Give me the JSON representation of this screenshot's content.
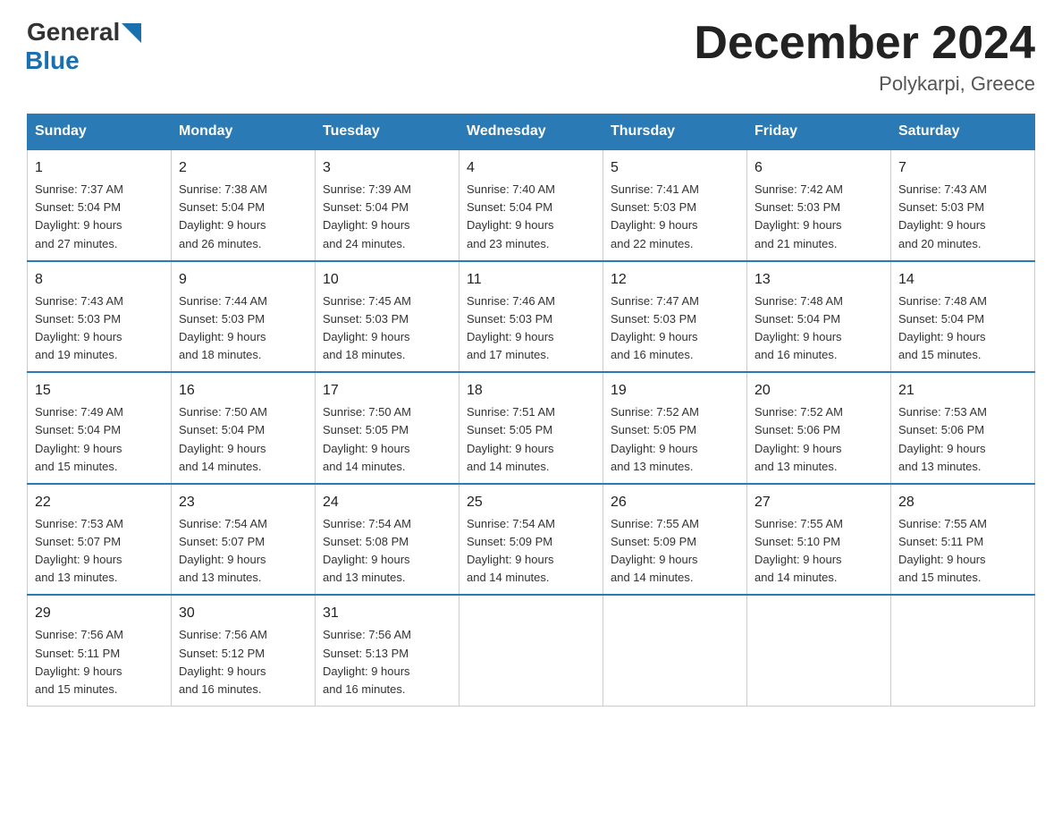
{
  "header": {
    "logo": {
      "general": "General",
      "blue": "Blue"
    },
    "title": "December 2024",
    "location": "Polykarpi, Greece"
  },
  "weekdays": [
    "Sunday",
    "Monday",
    "Tuesday",
    "Wednesday",
    "Thursday",
    "Friday",
    "Saturday"
  ],
  "weeks": [
    [
      {
        "day": "1",
        "sunrise": "7:37 AM",
        "sunset": "5:04 PM",
        "daylight": "9 hours and 27 minutes."
      },
      {
        "day": "2",
        "sunrise": "7:38 AM",
        "sunset": "5:04 PM",
        "daylight": "9 hours and 26 minutes."
      },
      {
        "day": "3",
        "sunrise": "7:39 AM",
        "sunset": "5:04 PM",
        "daylight": "9 hours and 24 minutes."
      },
      {
        "day": "4",
        "sunrise": "7:40 AM",
        "sunset": "5:04 PM",
        "daylight": "9 hours and 23 minutes."
      },
      {
        "day": "5",
        "sunrise": "7:41 AM",
        "sunset": "5:03 PM",
        "daylight": "9 hours and 22 minutes."
      },
      {
        "day": "6",
        "sunrise": "7:42 AM",
        "sunset": "5:03 PM",
        "daylight": "9 hours and 21 minutes."
      },
      {
        "day": "7",
        "sunrise": "7:43 AM",
        "sunset": "5:03 PM",
        "daylight": "9 hours and 20 minutes."
      }
    ],
    [
      {
        "day": "8",
        "sunrise": "7:43 AM",
        "sunset": "5:03 PM",
        "daylight": "9 hours and 19 minutes."
      },
      {
        "day": "9",
        "sunrise": "7:44 AM",
        "sunset": "5:03 PM",
        "daylight": "9 hours and 18 minutes."
      },
      {
        "day": "10",
        "sunrise": "7:45 AM",
        "sunset": "5:03 PM",
        "daylight": "9 hours and 18 minutes."
      },
      {
        "day": "11",
        "sunrise": "7:46 AM",
        "sunset": "5:03 PM",
        "daylight": "9 hours and 17 minutes."
      },
      {
        "day": "12",
        "sunrise": "7:47 AM",
        "sunset": "5:03 PM",
        "daylight": "9 hours and 16 minutes."
      },
      {
        "day": "13",
        "sunrise": "7:48 AM",
        "sunset": "5:04 PM",
        "daylight": "9 hours and 16 minutes."
      },
      {
        "day": "14",
        "sunrise": "7:48 AM",
        "sunset": "5:04 PM",
        "daylight": "9 hours and 15 minutes."
      }
    ],
    [
      {
        "day": "15",
        "sunrise": "7:49 AM",
        "sunset": "5:04 PM",
        "daylight": "9 hours and 15 minutes."
      },
      {
        "day": "16",
        "sunrise": "7:50 AM",
        "sunset": "5:04 PM",
        "daylight": "9 hours and 14 minutes."
      },
      {
        "day": "17",
        "sunrise": "7:50 AM",
        "sunset": "5:05 PM",
        "daylight": "9 hours and 14 minutes."
      },
      {
        "day": "18",
        "sunrise": "7:51 AM",
        "sunset": "5:05 PM",
        "daylight": "9 hours and 14 minutes."
      },
      {
        "day": "19",
        "sunrise": "7:52 AM",
        "sunset": "5:05 PM",
        "daylight": "9 hours and 13 minutes."
      },
      {
        "day": "20",
        "sunrise": "7:52 AM",
        "sunset": "5:06 PM",
        "daylight": "9 hours and 13 minutes."
      },
      {
        "day": "21",
        "sunrise": "7:53 AM",
        "sunset": "5:06 PM",
        "daylight": "9 hours and 13 minutes."
      }
    ],
    [
      {
        "day": "22",
        "sunrise": "7:53 AM",
        "sunset": "5:07 PM",
        "daylight": "9 hours and 13 minutes."
      },
      {
        "day": "23",
        "sunrise": "7:54 AM",
        "sunset": "5:07 PM",
        "daylight": "9 hours and 13 minutes."
      },
      {
        "day": "24",
        "sunrise": "7:54 AM",
        "sunset": "5:08 PM",
        "daylight": "9 hours and 13 minutes."
      },
      {
        "day": "25",
        "sunrise": "7:54 AM",
        "sunset": "5:09 PM",
        "daylight": "9 hours and 14 minutes."
      },
      {
        "day": "26",
        "sunrise": "7:55 AM",
        "sunset": "5:09 PM",
        "daylight": "9 hours and 14 minutes."
      },
      {
        "day": "27",
        "sunrise": "7:55 AM",
        "sunset": "5:10 PM",
        "daylight": "9 hours and 14 minutes."
      },
      {
        "day": "28",
        "sunrise": "7:55 AM",
        "sunset": "5:11 PM",
        "daylight": "9 hours and 15 minutes."
      }
    ],
    [
      {
        "day": "29",
        "sunrise": "7:56 AM",
        "sunset": "5:11 PM",
        "daylight": "9 hours and 15 minutes."
      },
      {
        "day": "30",
        "sunrise": "7:56 AM",
        "sunset": "5:12 PM",
        "daylight": "9 hours and 16 minutes."
      },
      {
        "day": "31",
        "sunrise": "7:56 AM",
        "sunset": "5:13 PM",
        "daylight": "9 hours and 16 minutes."
      },
      null,
      null,
      null,
      null
    ]
  ]
}
